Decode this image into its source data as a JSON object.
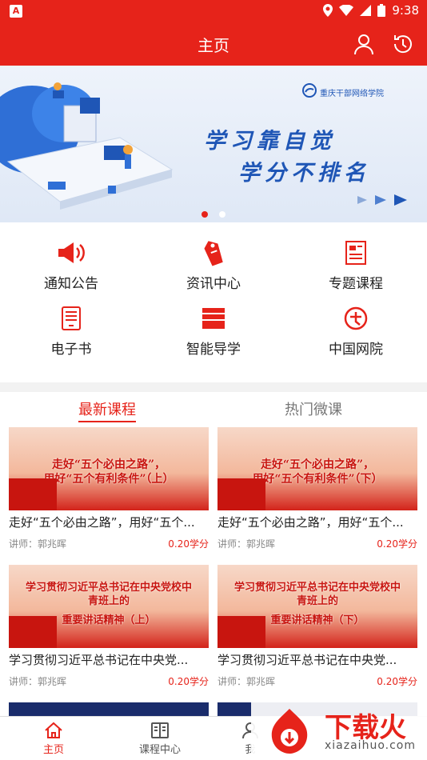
{
  "status_bar": {
    "time": "9:38"
  },
  "header": {
    "title": "主页"
  },
  "banner": {
    "school_name": "重庆干部网络学院",
    "slogan_line1": "学习靠自觉",
    "slogan_line2": "学分不排名"
  },
  "menu": {
    "items": [
      {
        "label": "通知公告",
        "icon": "megaphone-icon"
      },
      {
        "label": "资讯中心",
        "icon": "tag-icon"
      },
      {
        "label": "专题课程",
        "icon": "document-icon"
      },
      {
        "label": "电子书",
        "icon": "ebook-icon"
      },
      {
        "label": "智能导学",
        "icon": "books-icon"
      },
      {
        "label": "中国网院",
        "icon": "china-net-icon"
      }
    ]
  },
  "tabs": {
    "latest": "最新课程",
    "hot": "热门微课"
  },
  "courses": [
    {
      "thumb_line1": "走好“五个必由之路”，",
      "thumb_line2": "用好“五个有利条件”（上）",
      "title": "走好“五个必由之路”，用好“五个...",
      "teacher": "讲师：郭兆晖",
      "credit": "0.20学分"
    },
    {
      "thumb_line1": "走好“五个必由之路”，",
      "thumb_line2": "用好“五个有利条件”（下）",
      "title": "走好“五个必由之路”，用好“五个...",
      "teacher": "讲师：郭兆晖",
      "credit": "0.20学分"
    },
    {
      "thumb_line1": "学习贯彻习近平总书记在中央党校中青班上的",
      "thumb_line2": "重要讲话精神（上）",
      "title": "学习贯彻习近平总书记在中央党...",
      "teacher": "讲师：郭兆晖",
      "credit": "0.20学分"
    },
    {
      "thumb_line1": "学习贯彻习近平总书记在中央党校中青班上的",
      "thumb_line2": "重要讲话精神（下）",
      "title": "学习贯彻习近平总书记在中央党...",
      "teacher": "讲师：郭兆晖",
      "credit": "0.20学分"
    }
  ],
  "bottom_nav": {
    "home": "主页",
    "course_center": "课程中心",
    "mine": "我"
  },
  "watermark": {
    "text": "下载火",
    "url": "xiazaihuo.com"
  },
  "colors": {
    "accent": "#e6231a"
  }
}
